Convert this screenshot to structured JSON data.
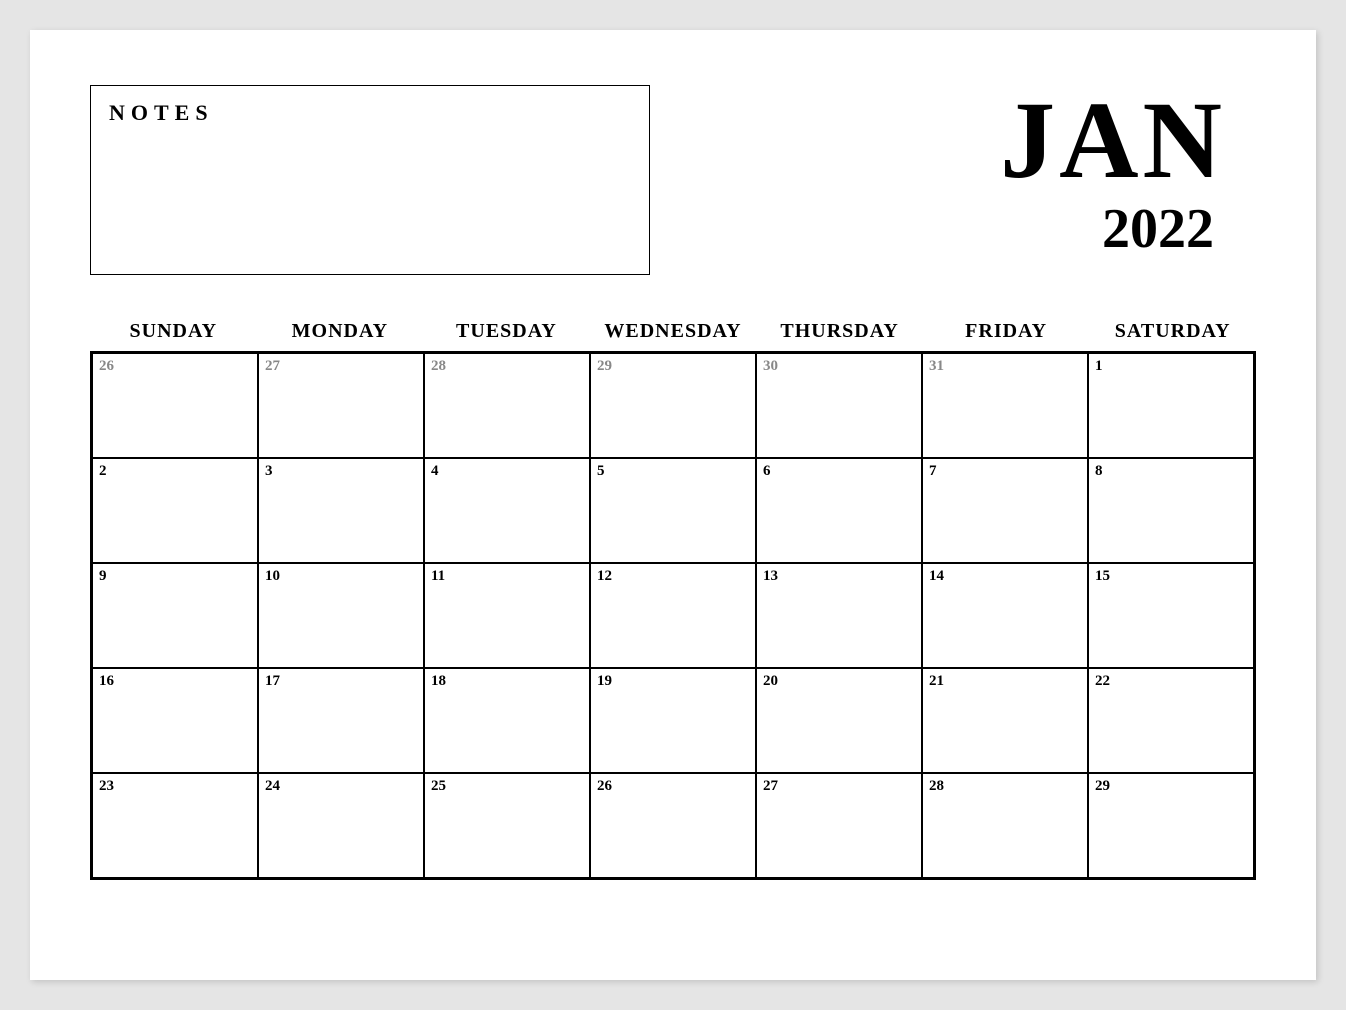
{
  "notes_label": "NOTES",
  "month": "JAN",
  "year": "2022",
  "weekdays": [
    "SUNDAY",
    "MONDAY",
    "TUESDAY",
    "WEDNESDAY",
    "THURSDAY",
    "FRIDAY",
    "SATURDAY"
  ],
  "days": [
    {
      "n": "26",
      "other": true
    },
    {
      "n": "27",
      "other": true
    },
    {
      "n": "28",
      "other": true
    },
    {
      "n": "29",
      "other": true
    },
    {
      "n": "30",
      "other": true
    },
    {
      "n": "31",
      "other": true
    },
    {
      "n": "1",
      "other": false
    },
    {
      "n": "2",
      "other": false
    },
    {
      "n": "3",
      "other": false
    },
    {
      "n": "4",
      "other": false
    },
    {
      "n": "5",
      "other": false
    },
    {
      "n": "6",
      "other": false
    },
    {
      "n": "7",
      "other": false
    },
    {
      "n": "8",
      "other": false
    },
    {
      "n": "9",
      "other": false
    },
    {
      "n": "10",
      "other": false
    },
    {
      "n": "11",
      "other": false
    },
    {
      "n": "12",
      "other": false
    },
    {
      "n": "13",
      "other": false
    },
    {
      "n": "14",
      "other": false
    },
    {
      "n": "15",
      "other": false
    },
    {
      "n": "16",
      "other": false
    },
    {
      "n": "17",
      "other": false
    },
    {
      "n": "18",
      "other": false
    },
    {
      "n": "19",
      "other": false
    },
    {
      "n": "20",
      "other": false
    },
    {
      "n": "21",
      "other": false
    },
    {
      "n": "22",
      "other": false
    },
    {
      "n": "23",
      "other": false
    },
    {
      "n": "24",
      "other": false
    },
    {
      "n": "25",
      "other": false
    },
    {
      "n": "26",
      "other": false
    },
    {
      "n": "27",
      "other": false
    },
    {
      "n": "28",
      "other": false
    },
    {
      "n": "29",
      "other": false
    }
  ]
}
